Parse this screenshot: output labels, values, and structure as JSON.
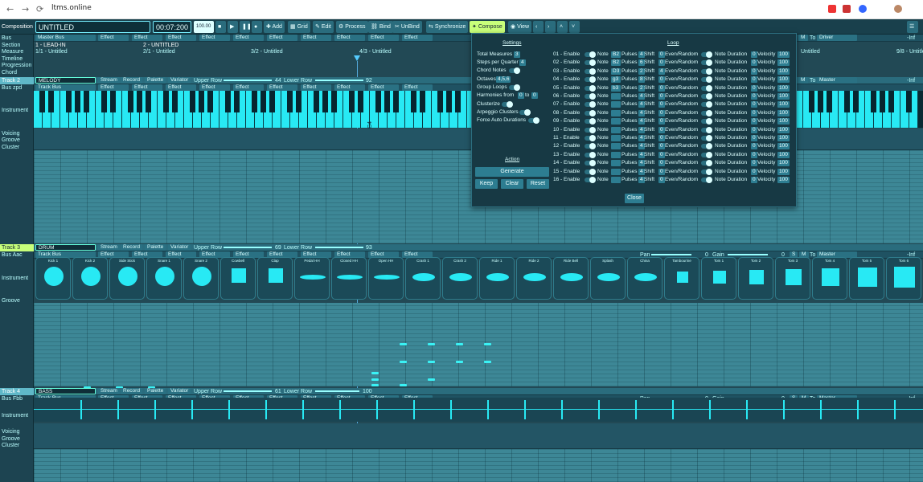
{
  "browser": {
    "url": "ltms.online",
    "back": "←",
    "forward": "→",
    "reload": "⟳"
  },
  "toolbar": {
    "composition": "Composition",
    "title": "UNTITLED",
    "time": "00:07:200",
    "tempo": "100.00",
    "add": "Add",
    "grid": "Grid",
    "edit": "Edit",
    "process": "Process",
    "bind": "Bind",
    "unbind": "UnBind",
    "synchronize": "Synchronize",
    "compose": "Compose",
    "view": "View"
  },
  "header_rows": {
    "bus": "Bus",
    "section": "Section",
    "measure": "Measure",
    "timeline": "Timeline",
    "progression": "Progression",
    "chord": "Chord",
    "master_bus": "Master Bus",
    "effect": "Effect",
    "section1": "1 - LEAD-IN",
    "section2": "2 - UNTITLED",
    "m1": "1/1 - Untitled",
    "m2": "2/1 - Untitled",
    "m3": "3/2 - Untitled",
    "m4": "4/3 - Untitled",
    "m5": "Untitled",
    "m6": "9/8 - Untitled",
    "inf": "-Inf",
    "m": "M",
    "to": "To",
    "driver": "Driver",
    "master": "Master"
  },
  "track2": {
    "label": "Track 2",
    "bus": "Bus zpd",
    "name": "MELODY",
    "stream": "Stream",
    "record": "Record",
    "palette": "Palette",
    "variator": "Variator",
    "upper_row": "Upper Row",
    "upper_val": "44",
    "lower_row": "Lower Row",
    "lower_val": "92",
    "track_bus": "Track Bus",
    "instrument": "Instrument",
    "voicing": "Voicing",
    "groove": "Groove",
    "cluster": "Cluster",
    "c4": "C4"
  },
  "track3": {
    "label": "Track 3",
    "bus": "Bus Aac",
    "name": "DRUM",
    "upper_val": "69",
    "lower_val": "93",
    "pan": "Pan",
    "pan_val": "0",
    "gain": "Gain",
    "gain_val": "0",
    "s": "S",
    "instrument": "Instrument",
    "groove": "Groove",
    "drums": [
      "Kick 1",
      "Kick 2",
      "Side Stick",
      "Snare 1",
      "Snare 2",
      "Cowbell",
      "Clap",
      "Pedal HH",
      "Closed HH",
      "Open HH",
      "Crash 1",
      "Crash 2",
      "Ride 1",
      "Ride 2",
      "Ride Bell",
      "Splash",
      "China",
      "Tambourine",
      "Tom 1",
      "Tom 2",
      "Tom 3",
      "Tom 4",
      "Tom 5",
      "Tom 6"
    ]
  },
  "track4": {
    "label": "Track 4",
    "bus": "Bus Fbb",
    "name": "BASS",
    "upper_val": "61",
    "lower_val": "100",
    "instrument": "Instrument",
    "voicing": "Voicing",
    "groove": "Groove",
    "cluster": "Cluster"
  },
  "compose_panel": {
    "settings": "Settings",
    "loop": "Loop",
    "total_measures": "Total Measures",
    "total_measures_val": "3",
    "steps_per_quarter": "Steps per Quarter",
    "steps_val": "4",
    "chord_notes": "Chord Notes",
    "octaves": "Octaves",
    "octaves_val": "4,5,6",
    "group_loops": "Group Loops",
    "harmonies_from": "Harmonies from",
    "h_from": "0",
    "h_to_lbl": "to",
    "h_to": "0",
    "clusterize": "Clusterize",
    "arpeggio": "Arpeggio Clusters",
    "force_auto": "Force Auto Durations",
    "action": "Action",
    "generate": "Generate",
    "keep": "Keep",
    "clear": "Clear",
    "reset": "Reset",
    "close": "Close",
    "loops": [
      {
        "id": "01 - Enable",
        "note": "B2",
        "pulses": "4",
        "shift": "0",
        "dur": "0",
        "vel": "100"
      },
      {
        "id": "02 - Enable",
        "note": "B2",
        "pulses": "6",
        "shift": "0",
        "dur": "0",
        "vel": "100"
      },
      {
        "id": "03 - Enable",
        "note": "D3",
        "pulses": "2",
        "shift": "4",
        "dur": "0",
        "vel": "100"
      },
      {
        "id": "04 - Enable",
        "note": "g3",
        "pulses": "8",
        "shift": "0",
        "dur": "0",
        "vel": "100"
      },
      {
        "id": "05 - Enable",
        "note": "b3",
        "pulses": "2",
        "shift": "0",
        "dur": "0",
        "vel": "100"
      },
      {
        "id": "06 - Enable",
        "note": "",
        "pulses": "4",
        "shift": "0",
        "dur": "0",
        "vel": "100"
      },
      {
        "id": "07 - Enable",
        "note": "",
        "pulses": "4",
        "shift": "0",
        "dur": "0",
        "vel": "100"
      },
      {
        "id": "08 - Enable",
        "note": "",
        "pulses": "4",
        "shift": "0",
        "dur": "0",
        "vel": "100"
      },
      {
        "id": "09 - Enable",
        "note": "",
        "pulses": "4",
        "shift": "0",
        "dur": "0",
        "vel": "100"
      },
      {
        "id": "10 - Enable",
        "note": "",
        "pulses": "4",
        "shift": "0",
        "dur": "0",
        "vel": "100"
      },
      {
        "id": "11 - Enable",
        "note": "",
        "pulses": "4",
        "shift": "0",
        "dur": "0",
        "vel": "100"
      },
      {
        "id": "12 - Enable",
        "note": "",
        "pulses": "4",
        "shift": "0",
        "dur": "0",
        "vel": "100"
      },
      {
        "id": "13 - Enable",
        "note": "",
        "pulses": "4",
        "shift": "0",
        "dur": "0",
        "vel": "100"
      },
      {
        "id": "14 - Enable",
        "note": "",
        "pulses": "4",
        "shift": "0",
        "dur": "0",
        "vel": "100"
      },
      {
        "id": "15 - Enable",
        "note": "",
        "pulses": "4",
        "shift": "0",
        "dur": "0",
        "vel": "100"
      },
      {
        "id": "16 - Enable",
        "note": "",
        "pulses": "4",
        "shift": "0",
        "dur": "0",
        "vel": "100"
      }
    ],
    "note_lbl": "Note",
    "pulses_lbl": "Pulses",
    "shift_lbl": "Shift",
    "even_lbl": "Even/Random",
    "dur_lbl": "Note Duration",
    "vel_lbl": "Velocity"
  },
  "colors": {
    "accent": "#28e9f4",
    "compose_active": "#c8ff7a",
    "background": "#224955"
  }
}
